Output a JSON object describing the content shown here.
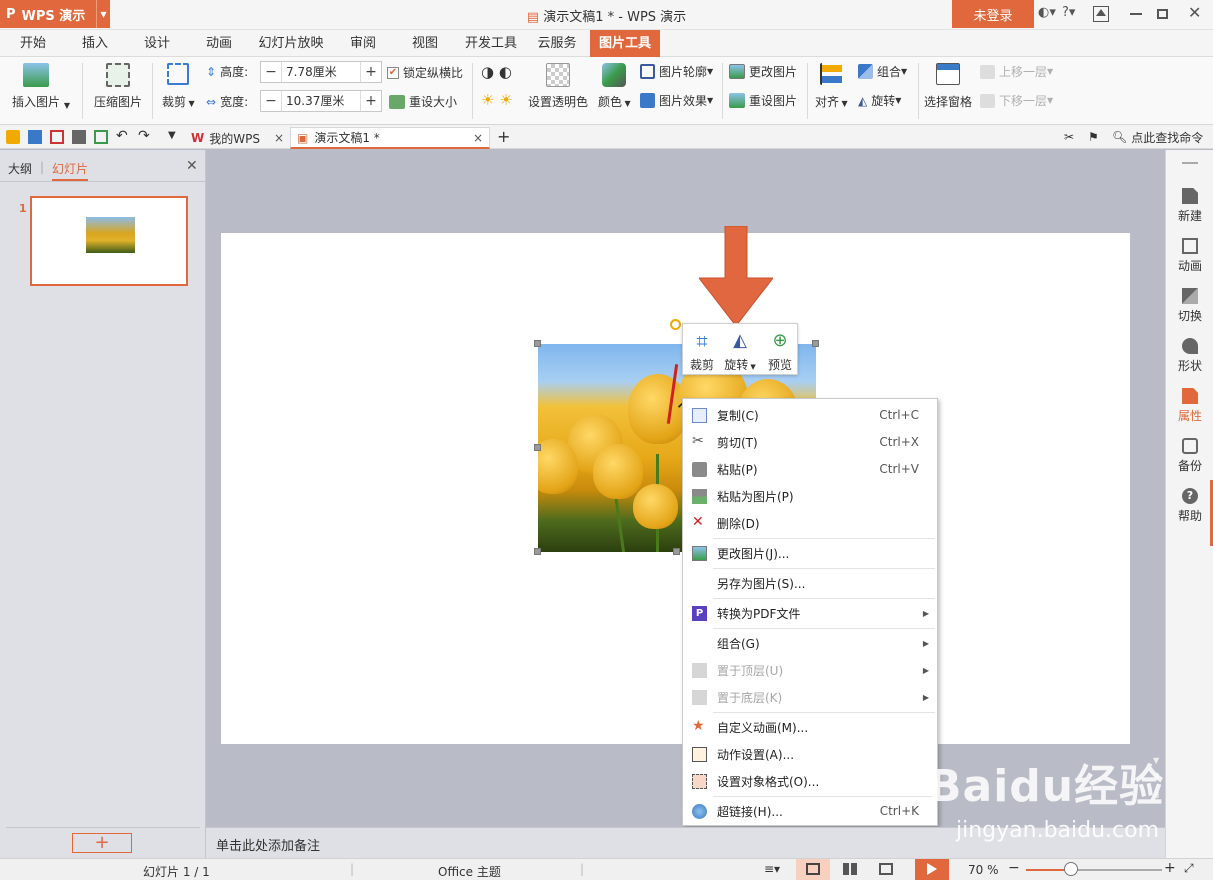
{
  "app": {
    "name": "WPS 演示",
    "title": "演示文稿1 * - WPS 演示",
    "login": "未登录"
  },
  "tabs": [
    "开始",
    "插入",
    "设计",
    "动画",
    "幻灯片放映",
    "审阅",
    "视图",
    "开发工具",
    "云服务",
    "图片工具"
  ],
  "active_tab": "图片工具",
  "ribbon": {
    "insert_picture": "插入图片",
    "compress": "压缩图片",
    "crop": "裁剪",
    "height_label": "高度:",
    "height_value": "7.78厘米",
    "width_label": "宽度:",
    "width_value": "10.37厘米",
    "lock_ratio": "锁定纵横比",
    "reset_size": "重设大小",
    "set_transparent": "设置透明色",
    "color": "颜色",
    "outline": "图片轮廓",
    "effects": "图片效果",
    "change_picture": "更改图片",
    "reset_picture": "重设图片",
    "align": "对齐",
    "group": "组合",
    "rotate": "旋转",
    "selection_pane": "选择窗格",
    "bring_forward": "上移一层",
    "send_backward": "下移一层"
  },
  "doc_tabs": [
    {
      "label": "我的WPS"
    },
    {
      "label": "演示文稿1 *"
    }
  ],
  "search": {
    "label": "点此查找命令"
  },
  "left_panel": {
    "tab_outline": "大纲",
    "tab_slides": "幻灯片",
    "slide_number": "1",
    "add": "+"
  },
  "mini_toolbar": [
    {
      "label": "裁剪"
    },
    {
      "label": "旋转"
    },
    {
      "label": "预览"
    }
  ],
  "context_menu": [
    {
      "label": "复制(C)",
      "shortcut": "Ctrl+C",
      "icon": "copy-icon"
    },
    {
      "label": "剪切(T)",
      "shortcut": "Ctrl+X",
      "icon": "cut-icon"
    },
    {
      "label": "粘贴(P)",
      "shortcut": "Ctrl+V",
      "icon": "paste-icon"
    },
    {
      "label": "粘贴为图片(P)",
      "shortcut": "",
      "icon": "paste-picture-icon"
    },
    {
      "label": "删除(D)",
      "shortcut": "",
      "icon": "delete-icon"
    },
    {
      "label": "更改图片(J)...",
      "shortcut": "",
      "icon": "change-picture-icon"
    },
    {
      "label": "另存为图片(S)...",
      "shortcut": "",
      "icon": ""
    },
    {
      "label": "转换为PDF文件",
      "shortcut": "",
      "icon": "pdf-icon"
    },
    {
      "label": "组合(G)",
      "shortcut": "",
      "icon": ""
    },
    {
      "label": "置于顶层(U)",
      "shortcut": "",
      "icon": "bring-to-front-icon"
    },
    {
      "label": "置于底层(K)",
      "shortcut": "",
      "icon": "send-to-back-icon"
    },
    {
      "label": "自定义动画(M)...",
      "shortcut": "",
      "icon": "custom-animation-icon"
    },
    {
      "label": "动作设置(A)...",
      "shortcut": "",
      "icon": "action-settings-icon"
    },
    {
      "label": "设置对象格式(O)...",
      "shortcut": "",
      "icon": "format-object-icon"
    },
    {
      "label": "超链接(H)...",
      "shortcut": "Ctrl+K",
      "icon": "hyperlink-icon"
    }
  ],
  "right_bar": [
    {
      "label": "新建"
    },
    {
      "label": "动画"
    },
    {
      "label": "切换"
    },
    {
      "label": "形状"
    },
    {
      "label": "属性"
    },
    {
      "label": "备份"
    },
    {
      "label": "帮助"
    }
  ],
  "notes": {
    "placeholder": "单击此处添加备注"
  },
  "status": {
    "slide": "幻灯片 1 / 1",
    "theme": "Office 主题",
    "zoom": "70 %"
  },
  "watermark": {
    "brand": "Baidu经验",
    "url": "jingyan.baidu.com"
  },
  "colors": {
    "accent": "#e0683c"
  }
}
